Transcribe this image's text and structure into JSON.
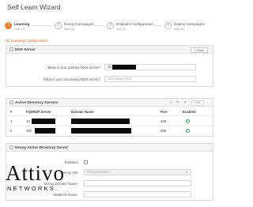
{
  "header": {
    "title": "Self Learn Wizard"
  },
  "steps": [
    {
      "num": "1",
      "label": "Learning",
      "sub": "Step 1/3"
    },
    {
      "num": "2",
      "label": "Decoy Campaigns",
      "sub": "Step 0/1"
    },
    {
      "num": "3",
      "label": "Endpoint Configuration",
      "sub": "Step 0/1"
    },
    {
      "num": "4",
      "label": "Deploy Campaigns",
      "sub": "Step 0/1"
    }
  ],
  "section_link": "AD Learning Configuration",
  "dns": {
    "title": "DNS Server",
    "save_label": "Save",
    "primary_label": "What is your primary DNS server?",
    "primary_value": "10.",
    "secondary_label": "What is your secondary DNS server?",
    "secondary_placeholder": "Secondary DNS"
  },
  "ad_servers": {
    "title": "Active Directory Servers",
    "test_label": "Test",
    "columns": [
      "#",
      "FQDN/IP Server",
      "Domain Name",
      "Port",
      "Enabled"
    ],
    "rows": [
      {
        "num": "1",
        "server": "10.",
        "port": "389"
      },
      {
        "num": "2",
        "server": "192.",
        "port": "389"
      }
    ]
  },
  "decoy_ad": {
    "title": "Decoy Active Directory Server",
    "enabled_label": "Enabled:",
    "vm_label": "Decoy VM:",
    "vm_placeholder": "Windows2008-1",
    "domain_label": "Decoy Domain Name:",
    "netbios_label": "NetBIOS Name:"
  },
  "logo": {
    "word": "Attivo",
    "sub": "NETWORKS."
  },
  "colors": {
    "accent": "#ee7a2c",
    "ok": "#3aa55a",
    "redaction": "#0b0b0b"
  }
}
